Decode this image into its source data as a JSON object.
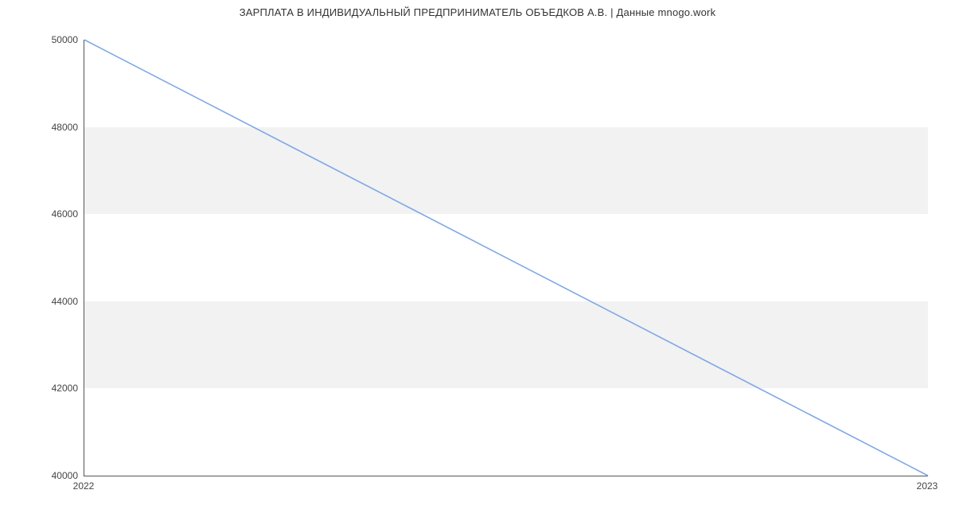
{
  "chart_data": {
    "type": "line",
    "title": "ЗАРПЛАТА В ИНДИВИДУАЛЬНЫЙ ПРЕДПРИНИМАТЕЛЬ ОБЪЕДКОВ А.В. | Данные mnogo.work",
    "xlabel": "",
    "ylabel": "",
    "x": [
      "2022",
      "2023"
    ],
    "y": [
      50000,
      40000
    ],
    "x_ticks": [
      "2022",
      "2023"
    ],
    "y_ticks": [
      40000,
      42000,
      44000,
      46000,
      48000,
      50000
    ],
    "ylim": [
      40000,
      50000
    ],
    "line_color": "#7fa8e6",
    "band_color": "#f2f2f2"
  }
}
